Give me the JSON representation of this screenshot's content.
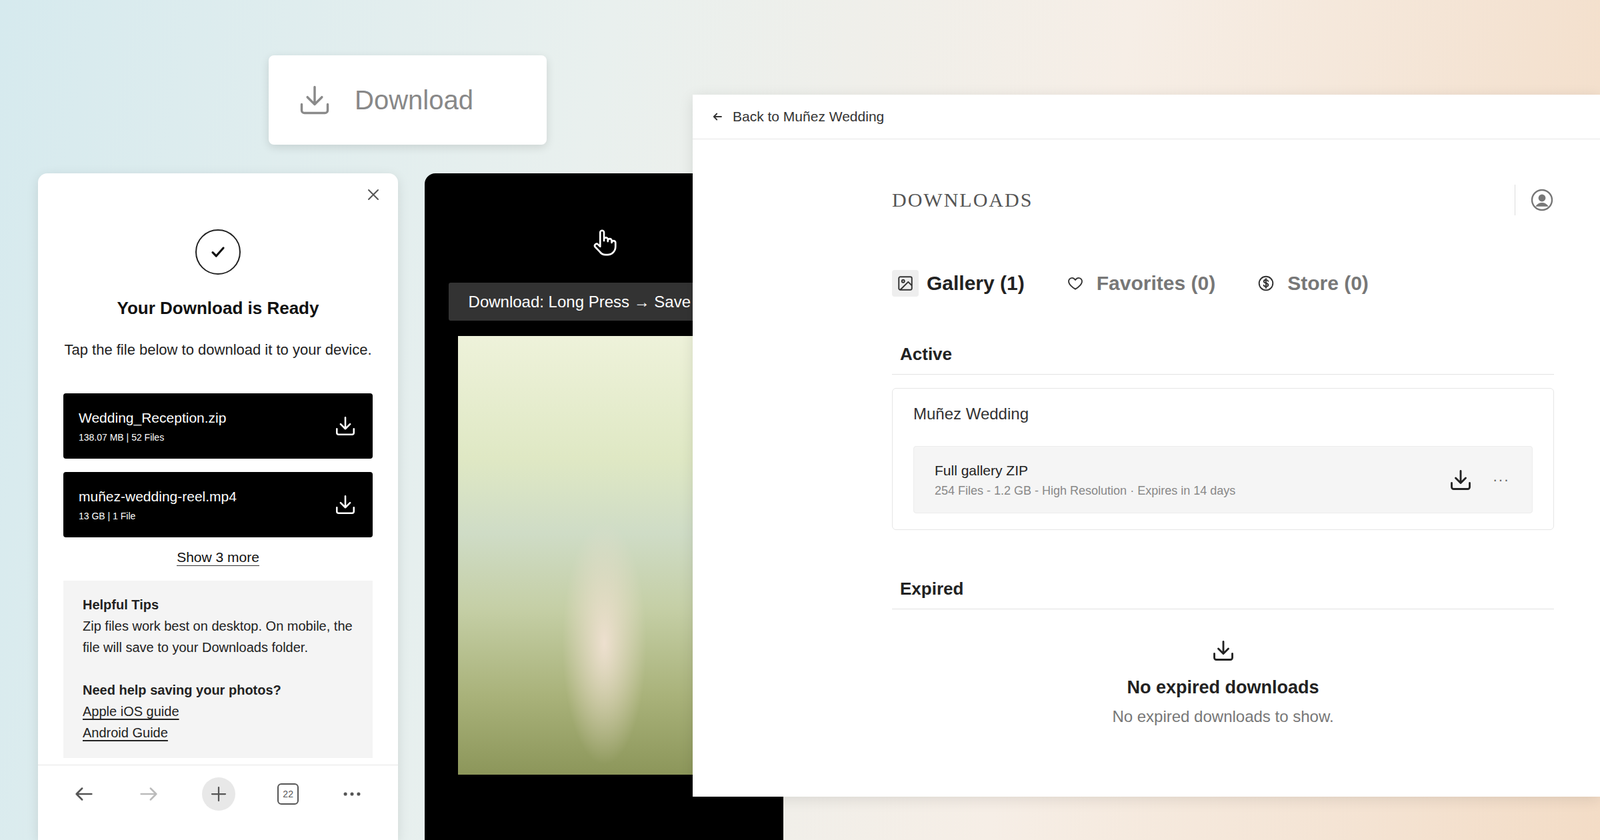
{
  "download_button": {
    "label": "Download"
  },
  "mobile_download": {
    "title": "Your Download is Ready",
    "instruction": "Tap the file below to download it to your device.",
    "files": [
      {
        "name": "Wedding_Reception.zip",
        "meta": "138.07 MB | 52 Files"
      },
      {
        "name": "muñez-wedding-reel.mp4",
        "meta": "13 GB | 1 File"
      }
    ],
    "show_more": "Show 3 more",
    "tips": {
      "title": "Helpful Tips",
      "text": "Zip files work best on desktop. On mobile, the file will save to your Downloads folder.",
      "help_title": "Need help saving your photos?",
      "links": [
        "Apple iOS guide",
        "Android Guide"
      ]
    },
    "browser_bar": {
      "tab_count": "22",
      "back_disabled": false,
      "forward_disabled": true
    }
  },
  "phone_viewer": {
    "instruction": "Download: Long Press → Save Image"
  },
  "desktop": {
    "back_link": "Back to Muñez Wedding",
    "title": "DOWNLOADS",
    "tabs": [
      {
        "label": "Gallery (1)",
        "selected": true
      },
      {
        "label": "Favorites (0)",
        "selected": false
      },
      {
        "label": "Store (0)",
        "selected": false
      }
    ],
    "active": {
      "title": "Active",
      "groups": [
        {
          "name": "Muñez Wedding",
          "items": [
            {
              "title": "Full gallery ZIP",
              "meta": "254 Files - 1.2 GB - High Resolution · Expires in 14 days",
              "more": "···"
            }
          ]
        }
      ]
    },
    "expired": {
      "title": "Expired",
      "empty_title": "No expired downloads",
      "empty_text": "No expired downloads to show."
    }
  }
}
